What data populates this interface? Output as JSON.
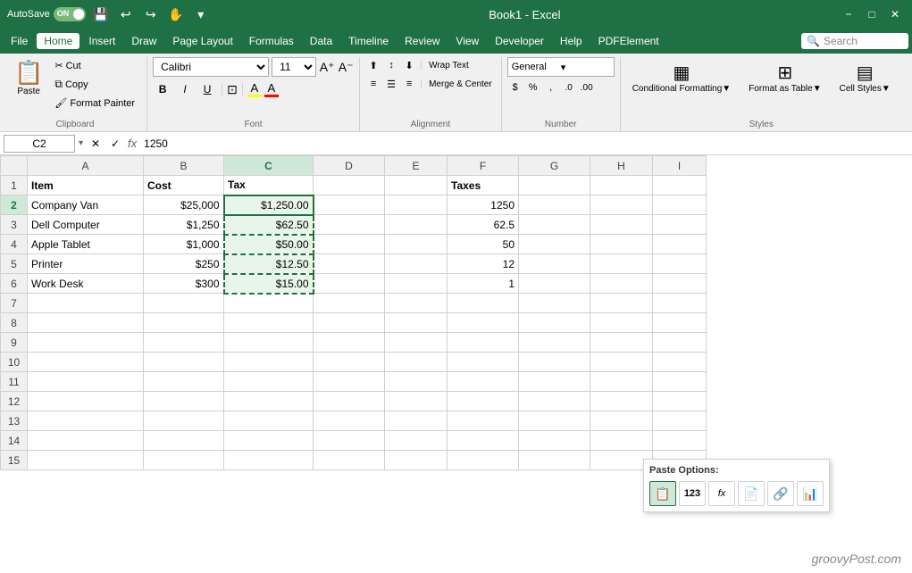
{
  "titleBar": {
    "autosave": "AutoSave",
    "autosave_state": "ON",
    "title": "Book1 - Excel",
    "search_placeholder": "Search"
  },
  "menuBar": {
    "items": [
      "File",
      "Home",
      "Insert",
      "Draw",
      "Page Layout",
      "Formulas",
      "Data",
      "Timeline",
      "Review",
      "View",
      "Developer",
      "Help",
      "PDFElement"
    ]
  },
  "ribbon": {
    "clipboard": {
      "label": "Clipboard",
      "paste": "Paste",
      "cut": "Cut",
      "copy": "Copy",
      "format_painter": "Format Painter"
    },
    "font": {
      "label": "Font",
      "name": "Calibri",
      "size": "11",
      "bold": "B",
      "italic": "I",
      "underline": "U"
    },
    "alignment": {
      "label": "Alignment",
      "wrap_text": "Wrap Text",
      "merge_center": "Merge & Center"
    },
    "number": {
      "label": "Number",
      "format": "General"
    },
    "styles": {
      "label": "Styles",
      "conditional_formatting": "Conditional Formatting▼",
      "format_as_table": "Format as Table▼",
      "cell_styles": "Cell Styles▼"
    }
  },
  "formulaBar": {
    "name_box": "C2",
    "formula_value": "1250"
  },
  "spreadsheet": {
    "columns": [
      "A",
      "B",
      "C",
      "D",
      "E",
      "F",
      "G",
      "H",
      "I"
    ],
    "rows": [
      {
        "row": "1",
        "cells": [
          {
            "col": "A",
            "val": "Item"
          },
          {
            "col": "B",
            "val": "Cost"
          },
          {
            "col": "C",
            "val": "Tax"
          },
          {
            "col": "D",
            "val": ""
          },
          {
            "col": "E",
            "val": ""
          },
          {
            "col": "F",
            "val": "Taxes"
          },
          {
            "col": "G",
            "val": ""
          },
          {
            "col": "H",
            "val": ""
          },
          {
            "col": "I",
            "val": ""
          }
        ]
      },
      {
        "row": "2",
        "cells": [
          {
            "col": "A",
            "val": "Company Van"
          },
          {
            "col": "B",
            "val": "$25,000"
          },
          {
            "col": "C",
            "val": "$1,250.00"
          },
          {
            "col": "D",
            "val": ""
          },
          {
            "col": "E",
            "val": ""
          },
          {
            "col": "F",
            "val": "1250"
          },
          {
            "col": "G",
            "val": ""
          },
          {
            "col": "H",
            "val": ""
          },
          {
            "col": "I",
            "val": ""
          }
        ]
      },
      {
        "row": "3",
        "cells": [
          {
            "col": "A",
            "val": "Dell Computer"
          },
          {
            "col": "B",
            "val": "$1,250"
          },
          {
            "col": "C",
            "val": "$62.50"
          },
          {
            "col": "D",
            "val": ""
          },
          {
            "col": "E",
            "val": ""
          },
          {
            "col": "F",
            "val": "62.5"
          },
          {
            "col": "G",
            "val": ""
          },
          {
            "col": "H",
            "val": ""
          },
          {
            "col": "I",
            "val": ""
          }
        ]
      },
      {
        "row": "4",
        "cells": [
          {
            "col": "A",
            "val": "Apple Tablet"
          },
          {
            "col": "B",
            "val": "$1,000"
          },
          {
            "col": "C",
            "val": "$50.00"
          },
          {
            "col": "D",
            "val": ""
          },
          {
            "col": "E",
            "val": ""
          },
          {
            "col": "F",
            "val": "50"
          },
          {
            "col": "G",
            "val": ""
          },
          {
            "col": "H",
            "val": ""
          },
          {
            "col": "I",
            "val": ""
          }
        ]
      },
      {
        "row": "5",
        "cells": [
          {
            "col": "A",
            "val": "Printer"
          },
          {
            "col": "B",
            "val": "$250"
          },
          {
            "col": "C",
            "val": "$12.50"
          },
          {
            "col": "D",
            "val": ""
          },
          {
            "col": "E",
            "val": ""
          },
          {
            "col": "F",
            "val": "12"
          },
          {
            "col": "G",
            "val": ""
          },
          {
            "col": "H",
            "val": ""
          },
          {
            "col": "I",
            "val": ""
          }
        ]
      },
      {
        "row": "6",
        "cells": [
          {
            "col": "A",
            "val": "Work Desk"
          },
          {
            "col": "B",
            "val": "$300"
          },
          {
            "col": "C",
            "val": "$15.00"
          },
          {
            "col": "D",
            "val": ""
          },
          {
            "col": "E",
            "val": ""
          },
          {
            "col": "F",
            "val": "1"
          },
          {
            "col": "G",
            "val": ""
          },
          {
            "col": "H",
            "val": ""
          },
          {
            "col": "I",
            "val": ""
          }
        ]
      },
      {
        "row": "7",
        "cells": []
      },
      {
        "row": "8",
        "cells": []
      },
      {
        "row": "9",
        "cells": []
      },
      {
        "row": "10",
        "cells": []
      },
      {
        "row": "11",
        "cells": []
      },
      {
        "row": "12",
        "cells": []
      },
      {
        "row": "13",
        "cells": []
      },
      {
        "row": "14",
        "cells": []
      },
      {
        "row": "15",
        "cells": []
      }
    ]
  },
  "pasteOptions": {
    "title": "Paste Options:",
    "buttons": [
      "📋",
      "1̲2̲3",
      "fx",
      "📄",
      "🔗",
      "📊"
    ]
  },
  "watermark": "groovyPost.com"
}
